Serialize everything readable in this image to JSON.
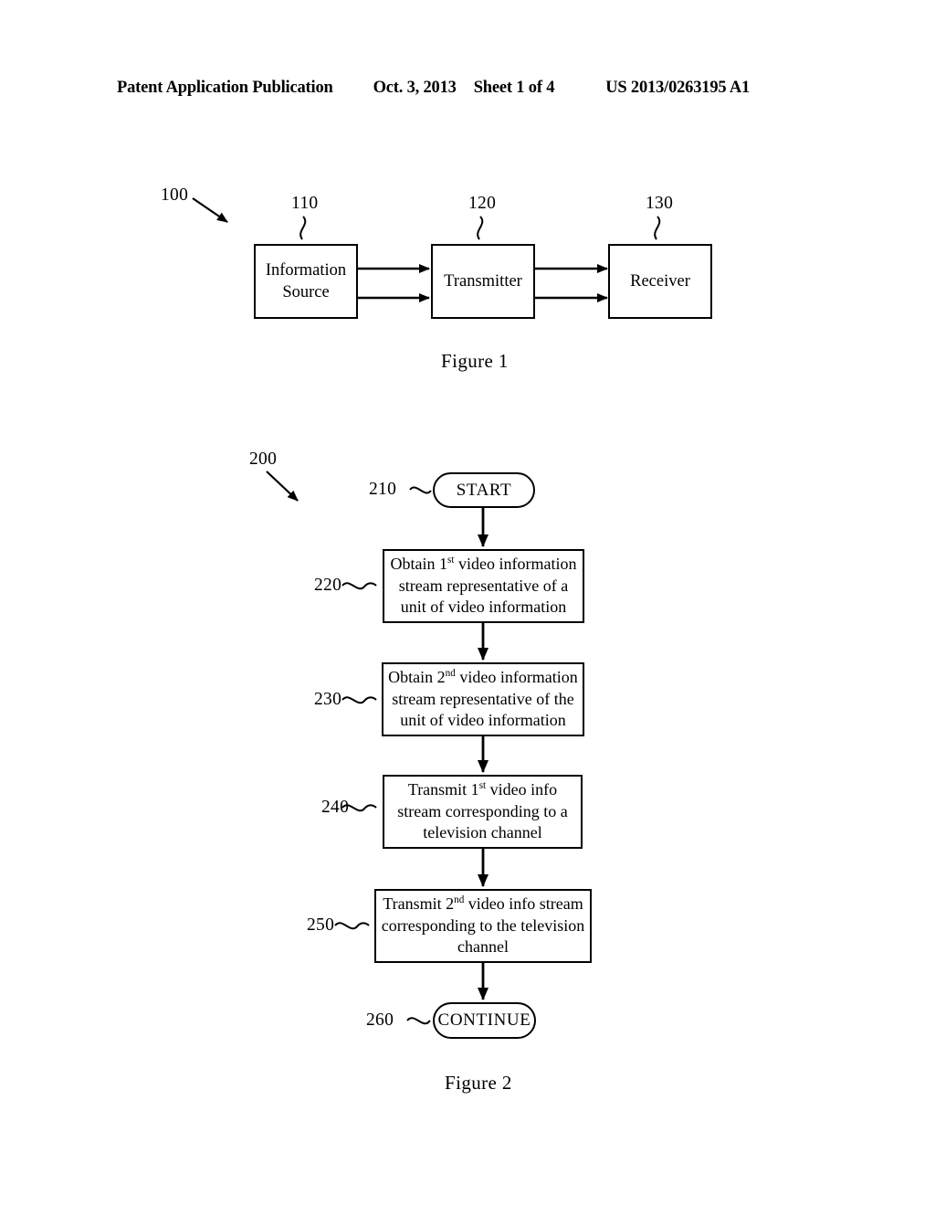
{
  "header": {
    "publication": "Patent Application Publication",
    "date": "Oct. 3, 2013",
    "sheet": "Sheet 1 of 4",
    "patent_number": "US 2013/0263195 A1"
  },
  "figure1": {
    "caption": "Figure 1",
    "system_ref": "100",
    "blocks": [
      {
        "ref": "110",
        "line1": "Information",
        "line2": "Source"
      },
      {
        "ref": "120",
        "line1": "Transmitter",
        "line2": ""
      },
      {
        "ref": "130",
        "line1": "Receiver",
        "line2": ""
      }
    ]
  },
  "figure2": {
    "caption": "Figure 2",
    "method_ref": "200",
    "steps": [
      {
        "ref": "210",
        "shape": "terminator",
        "label": "START",
        "lines": [
          "START"
        ]
      },
      {
        "ref": "220",
        "shape": "process",
        "label": "Obtain 1st video information stream representative of a unit of video information",
        "lines": [
          {
            "pre": "Obtain 1",
            "sup": "st",
            "post": " video information"
          },
          {
            "pre": "stream representative of a",
            "sup": "",
            "post": ""
          },
          {
            "pre": "unit of video information",
            "sup": "",
            "post": ""
          }
        ]
      },
      {
        "ref": "230",
        "shape": "process",
        "label": "Obtain 2nd video information stream representative of the unit of video information",
        "lines": [
          {
            "pre": "Obtain 2",
            "sup": "nd",
            "post": " video information"
          },
          {
            "pre": "stream representative of the",
            "sup": "",
            "post": ""
          },
          {
            "pre": "unit of video information",
            "sup": "",
            "post": ""
          }
        ]
      },
      {
        "ref": "240",
        "shape": "process",
        "label": "Transmit 1st video info stream corresponding to a television channel",
        "lines": [
          {
            "pre": "Transmit 1",
            "sup": "st",
            "post": " video info"
          },
          {
            "pre": "stream corresponding to a",
            "sup": "",
            "post": ""
          },
          {
            "pre": "television channel",
            "sup": "",
            "post": ""
          }
        ]
      },
      {
        "ref": "250",
        "shape": "process",
        "label": "Transmit 2nd video info stream corresponding to the television channel",
        "lines": [
          {
            "pre": "Transmit 2",
            "sup": "nd",
            "post": " video info stream"
          },
          {
            "pre": "corresponding to the television",
            "sup": "",
            "post": ""
          },
          {
            "pre": "channel",
            "sup": "",
            "post": ""
          }
        ]
      },
      {
        "ref": "260",
        "shape": "terminator",
        "label": "CONTINUE",
        "lines": [
          "CONTINUE"
        ]
      }
    ]
  },
  "colors": {
    "ink": "#000000",
    "paper": "#ffffff"
  }
}
